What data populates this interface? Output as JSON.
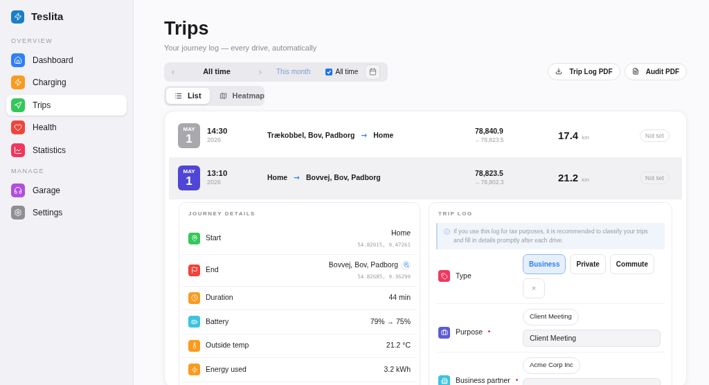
{
  "sidebar": {
    "app_name": "Teslita",
    "sections": [
      {
        "heading": "OVERVIEW",
        "items": [
          {
            "label": "Dashboard",
            "selected": false,
            "color": "#2f80f5"
          },
          {
            "label": "Charging",
            "selected": false,
            "color": "#fb9a1e"
          },
          {
            "label": "Trips",
            "selected": true,
            "color": "#34c759"
          },
          {
            "label": "Health",
            "selected": false,
            "color": "#f0443a"
          },
          {
            "label": "Statistics",
            "selected": false,
            "color": "#f0385f"
          }
        ]
      },
      {
        "heading": "MANAGE",
        "items": [
          {
            "label": "Garage",
            "selected": false,
            "color": "#b24ee0"
          },
          {
            "label": "Settings",
            "selected": false,
            "color": "#8e8e93"
          }
        ]
      }
    ]
  },
  "page": {
    "title": "Trips",
    "subtitle": "Your journey log — every drive, automatically"
  },
  "period": {
    "prev": "‹",
    "label": "All time",
    "next": "›",
    "month_button": {
      "label": "This month",
      "disabled": true
    },
    "all_time": {
      "label": "All time",
      "checked": true
    }
  },
  "exports": [
    "Trip Log PDF",
    "Audit PDF"
  ],
  "views": [
    {
      "label": "List",
      "selected": true
    },
    {
      "label": "Heatmap",
      "selected": false
    }
  ],
  "trips": [
    {
      "month": "MAY",
      "day": "1",
      "time": "14:30",
      "year": "2026",
      "from": "Trækobbel, Bov, Padborg",
      "arrow": "→",
      "to": "Home",
      "odometer": "78,840.9",
      "odometer_prev": "←78,823.5",
      "distance": "17.4",
      "unit": "km",
      "status": "Not set",
      "selected": false
    },
    {
      "month": "MAY",
      "day": "1",
      "time": "13:10",
      "year": "2026",
      "from": "Home",
      "arrow": "→",
      "to": "Bovvej, Bov, Padborg",
      "odometer": "78,823.5",
      "odometer_prev": "←78,802.3",
      "distance": "21.2",
      "unit": "km",
      "status": "Not set",
      "selected": true
    }
  ],
  "journey_details": {
    "heading": "JOURNEY DETAILS",
    "rows": [
      {
        "label": "Start",
        "value": "Home",
        "coords": "54.82015, 9.47261",
        "color": "#34c759"
      },
      {
        "label": "End",
        "value": "Bovvej, Bov, Padborg",
        "coords": "54.82685, 9.36299",
        "color": "#f0443a",
        "pin_button": true
      },
      {
        "label": "Duration",
        "value": "44 min",
        "color": "#fb9a1e"
      },
      {
        "label": "Battery",
        "value": "79% → 75%",
        "color": "#3cc3e0"
      },
      {
        "label": "Outside temp",
        "value": "21.2 °C",
        "color": "#fb9a1e"
      },
      {
        "label": "Energy used",
        "value": "3.2 kWh",
        "color": "#fb9a1e"
      }
    ]
  },
  "trip_log": {
    "heading": "TRIP LOG",
    "note": "If you use this log for tax purposes, it is recommended to classify your trips and fill in details promptly after each drive.",
    "type": {
      "label": "Type",
      "color": "#f0385f",
      "options": [
        {
          "label": "Business",
          "selected": true
        },
        {
          "label": "Private",
          "selected": false
        },
        {
          "label": "Commute",
          "selected": false
        }
      ],
      "clear": "×"
    },
    "fields": [
      {
        "label": "Purpose",
        "required": true,
        "color": "#5b5bd6",
        "suggestion": "Client Meeting",
        "value": "Client Meeting"
      },
      {
        "label": "Business partner",
        "required": true,
        "color": "#3cc3e0",
        "suggestion": "Acme Corp Inc"
      }
    ]
  }
}
